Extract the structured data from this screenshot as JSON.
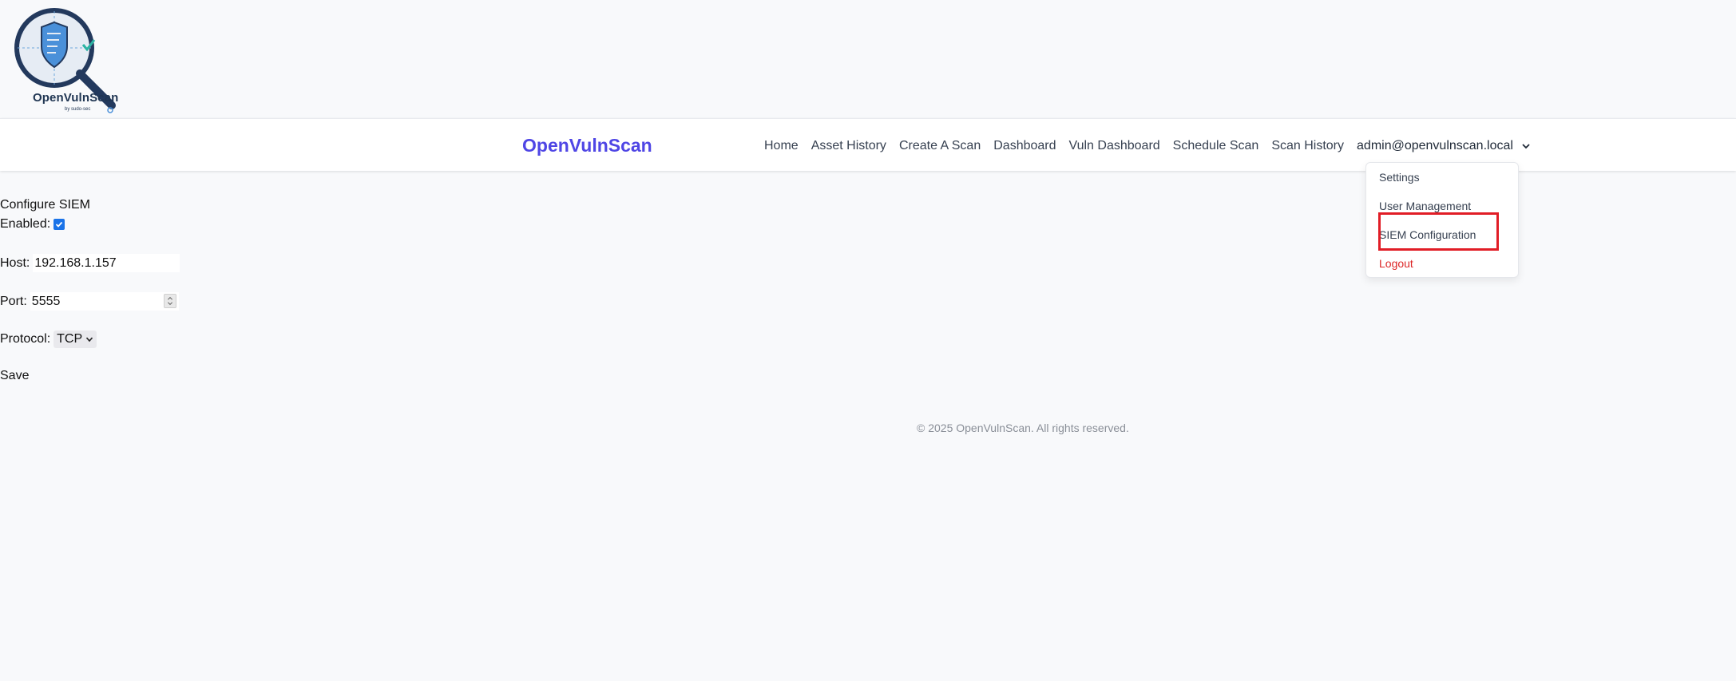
{
  "logo": {
    "name": "OpenVulnScan",
    "sub": "by sudo-sec"
  },
  "navbar": {
    "brand": "OpenVulnScan",
    "links": [
      "Home",
      "Asset History",
      "Create A Scan",
      "Dashboard",
      "Vuln Dashboard",
      "Schedule Scan",
      "Scan History"
    ],
    "user_email": "admin@openvulnscan.local"
  },
  "dropdown": {
    "items": [
      "Settings",
      "User Management",
      "SIEM Configuration",
      "Logout"
    ]
  },
  "form": {
    "title": "Configure SIEM",
    "enabled_label": "Enabled:",
    "enabled": true,
    "host_label": "Host:",
    "host_value": "192.168.1.157",
    "port_label": "Port:",
    "port_value": "5555",
    "protocol_label": "Protocol:",
    "protocol_value": "TCP",
    "save_label": "Save"
  },
  "footer": {
    "text": "© 2025 OpenVulnScan. All rights reserved."
  },
  "colors": {
    "brand": "#4f46e5",
    "logout": "#dc2626",
    "highlight": "#e11d26",
    "checkbox": "#1a73e8"
  }
}
